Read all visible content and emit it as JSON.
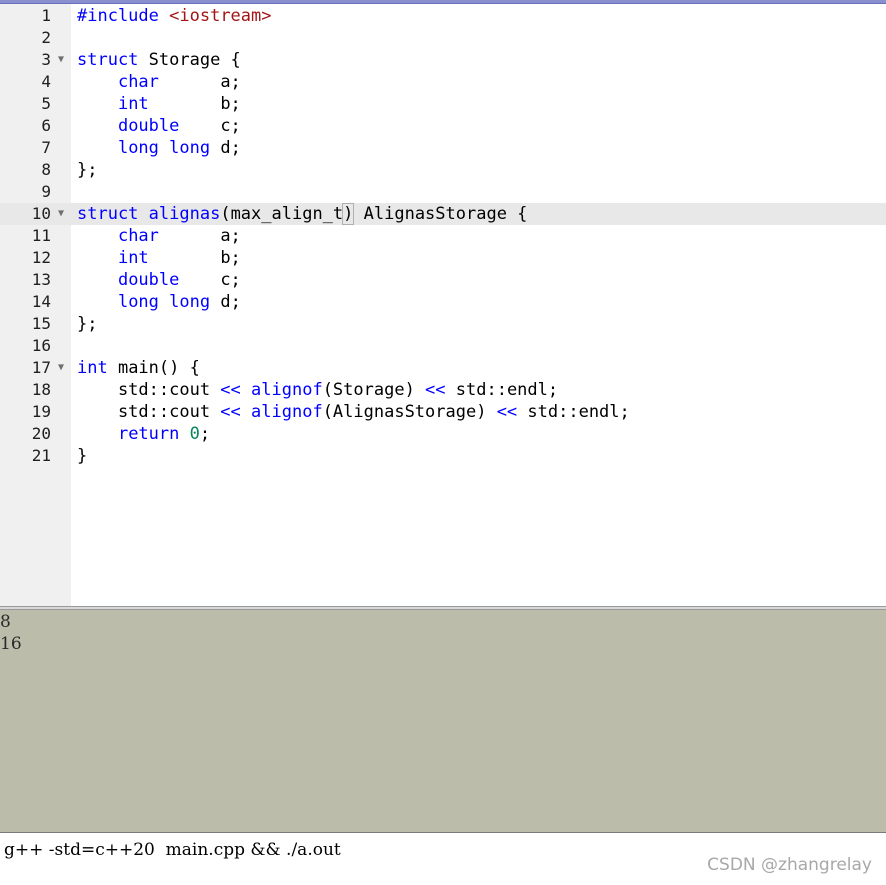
{
  "editor": {
    "current_line": 10,
    "lines": [
      {
        "n": "1",
        "fold": "",
        "html": "<span class=\"pp\">#include</span> <span class=\"str\">&lt;iostream&gt;</span>"
      },
      {
        "n": "2",
        "fold": "",
        "html": ""
      },
      {
        "n": "3",
        "fold": "▼",
        "html": "<span class=\"kw\">struct</span> Storage {"
      },
      {
        "n": "4",
        "fold": "",
        "html": "    <span class=\"kw\">char</span>      a;"
      },
      {
        "n": "5",
        "fold": "",
        "html": "    <span class=\"kw\">int</span>       b;"
      },
      {
        "n": "6",
        "fold": "",
        "html": "    <span class=\"kw\">double</span>    c;"
      },
      {
        "n": "7",
        "fold": "",
        "html": "    <span class=\"kw\">long</span> <span class=\"kw\">long</span> d;"
      },
      {
        "n": "8",
        "fold": "",
        "html": "};"
      },
      {
        "n": "9",
        "fold": "",
        "html": ""
      },
      {
        "n": "10",
        "fold": "▼",
        "html": "<span class=\"kw\">struct</span> <span class=\"kw\">alignas</span>(max_align_t<span class=\"brace-match\">)</span> AlignasStorage {"
      },
      {
        "n": "11",
        "fold": "",
        "html": "    <span class=\"kw\">char</span>      a;"
      },
      {
        "n": "12",
        "fold": "",
        "html": "    <span class=\"kw\">int</span>       b;"
      },
      {
        "n": "13",
        "fold": "",
        "html": "    <span class=\"kw\">double</span>    c;"
      },
      {
        "n": "14",
        "fold": "",
        "html": "    <span class=\"kw\">long</span> <span class=\"kw\">long</span> d;"
      },
      {
        "n": "15",
        "fold": "",
        "html": "};"
      },
      {
        "n": "16",
        "fold": "",
        "html": ""
      },
      {
        "n": "17",
        "fold": "▼",
        "html": "<span class=\"kw\">int</span> main() {"
      },
      {
        "n": "18",
        "fold": "",
        "html": "    std::cout <span class=\"kw\">&lt;&lt;</span> <span class=\"kw\">alignof</span>(Storage) <span class=\"kw\">&lt;&lt;</span> std::endl;"
      },
      {
        "n": "19",
        "fold": "",
        "html": "    std::cout <span class=\"kw\">&lt;&lt;</span> <span class=\"kw\">alignof</span>(AlignasStorage) <span class=\"kw\">&lt;&lt;</span> std::endl;"
      },
      {
        "n": "20",
        "fold": "",
        "html": "    <span class=\"kw\">return</span> <span class=\"num\">0</span>;"
      },
      {
        "n": "21",
        "fold": "",
        "html": "}"
      }
    ]
  },
  "output": {
    "lines": [
      "8",
      "16"
    ]
  },
  "command": {
    "value": "g++ -std=c++20  main.cpp && ./a.out"
  },
  "watermark": "CSDN @zhangrelay",
  "colors": {
    "keyword": "#0000ff",
    "string": "#a31515",
    "number": "#098658",
    "output_bg": "#bbbcaa",
    "gutter_bg": "#f0f0f0"
  }
}
